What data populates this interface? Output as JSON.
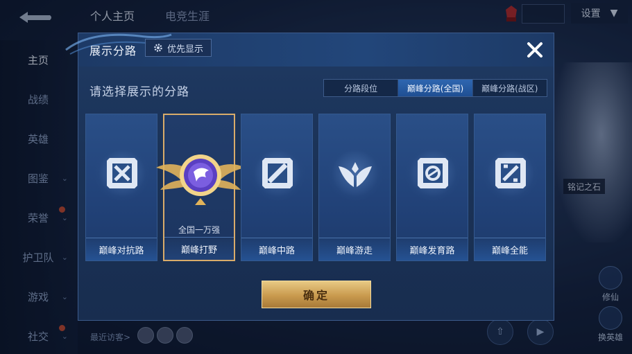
{
  "header": {
    "tabs": [
      "个人主页",
      "电竞生涯"
    ],
    "settings_label": "设置"
  },
  "left_nav": {
    "items": [
      {
        "label": "主页",
        "active": true,
        "chevron": false
      },
      {
        "label": "战绩",
        "active": false,
        "chevron": false
      },
      {
        "label": "英雄",
        "active": false,
        "chevron": false
      },
      {
        "label": "图鉴",
        "active": false,
        "chevron": true
      },
      {
        "label": "荣誉",
        "active": false,
        "chevron": true
      },
      {
        "label": "护卫队",
        "active": false,
        "chevron": true
      },
      {
        "label": "游戏",
        "active": false,
        "chevron": true
      },
      {
        "label": "社交",
        "active": false,
        "chevron": true
      }
    ]
  },
  "background": {
    "hero_tag": "铭记之石",
    "right_buttons": [
      "修仙",
      "换英雄"
    ],
    "recent_visitors": "最近访客>"
  },
  "modal": {
    "title": "展示分路",
    "pref_button": "优先显示",
    "subtitle": "请选择展示的分路",
    "tabs": [
      {
        "label": "分路段位",
        "active": false
      },
      {
        "label": "巅峰分路(全国)",
        "active": true
      },
      {
        "label": "巅峰分路(战区)",
        "active": false
      }
    ],
    "cards": [
      {
        "label": "巅峰对抗路",
        "icon": "clash-lane-icon",
        "selected": false
      },
      {
        "label": "巅峰打野",
        "icon": "jungle-rank-badge-icon",
        "selected": true,
        "rank": "全国一万强"
      },
      {
        "label": "巅峰中路",
        "icon": "mid-lane-icon",
        "selected": false
      },
      {
        "label": "巅峰游走",
        "icon": "roam-icon",
        "selected": false
      },
      {
        "label": "巅峰发育路",
        "icon": "farm-lane-icon",
        "selected": false
      },
      {
        "label": "巅峰全能",
        "icon": "all-round-icon",
        "selected": false
      }
    ],
    "confirm_label": "确定"
  },
  "colors": {
    "accent_gold": "#d9ac6a",
    "tab_active": "#2f66b0",
    "panel": "#1b3358"
  }
}
